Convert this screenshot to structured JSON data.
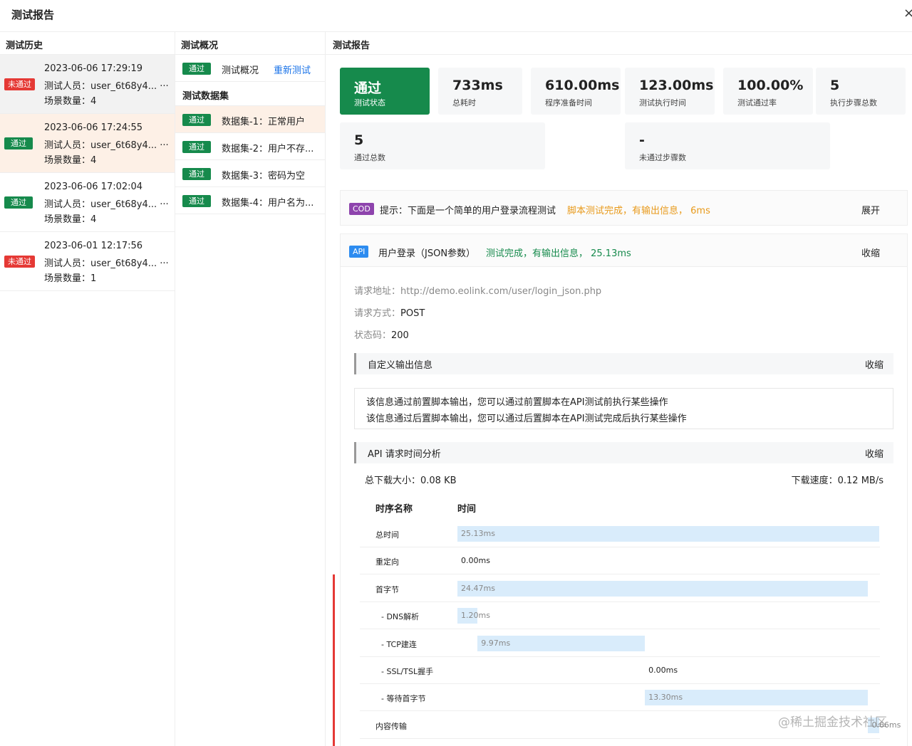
{
  "header": {
    "title": "测试报告",
    "close": "×"
  },
  "history": {
    "title": "测试历史",
    "items": [
      {
        "status": "未通过",
        "time": "2023-06-06 17:29:19",
        "tester": "测试人员：user_6t68y4... ···",
        "scenes": "场景数量：4"
      },
      {
        "status": "通过",
        "time": "2023-06-06 17:24:55",
        "tester": "测试人员：user_6t68y4... ···",
        "scenes": "场景数量：4"
      },
      {
        "status": "通过",
        "time": "2023-06-06 17:02:04",
        "tester": "测试人员：user_6t68y4... ···",
        "scenes": "场景数量：4"
      },
      {
        "status": "未通过",
        "time": "2023-06-01 12:17:56",
        "tester": "测试人员：user_6t68y4... ···",
        "scenes": "场景数量：1"
      }
    ]
  },
  "overview": {
    "title": "测试概况",
    "row": {
      "status": "通过",
      "label": "测试概况",
      "link": "重新测试"
    },
    "datasets_title": "测试数据集",
    "datasets": [
      {
        "status": "通过",
        "label": "数据集-1：正常用户"
      },
      {
        "status": "通过",
        "label": "数据集-2：用户不存..."
      },
      {
        "status": "通过",
        "label": "数据集-3：密码为空"
      },
      {
        "status": "通过",
        "label": "数据集-4：用户名为..."
      }
    ]
  },
  "report": {
    "title": "测试报告",
    "stats": [
      {
        "value": "通过",
        "label": "测试状态"
      },
      {
        "value": "733ms",
        "label": "总耗时"
      },
      {
        "value": "610.00ms",
        "label": "程序准备时间"
      },
      {
        "value": "123.00ms",
        "label": "测试执行时间"
      },
      {
        "value": "100.00%",
        "label": "测试通过率"
      },
      {
        "value": "5",
        "label": "执行步骤总数"
      },
      {
        "value": "5",
        "label": "通过总数"
      },
      {
        "value": "-",
        "label": "未通过步骤数"
      }
    ],
    "cod": {
      "badge": "COD",
      "text": "提示：下面是一个简单的用户登录流程测试",
      "result": "脚本测试完成，有输出信息， 6ms",
      "action": "展开"
    },
    "api": {
      "badge": "API",
      "text": "用户登录（JSON参数）",
      "result": "测试完成，有输出信息， 25.13ms",
      "action": "收缩"
    },
    "request": {
      "url_label": "请求地址：",
      "url": "http://demo.eolink.com/user/login_json.php",
      "method_label": "请求方式：",
      "method": "POST",
      "code_label": "状态码：",
      "code": "200"
    },
    "custom_output": {
      "title": "自定义输出信息",
      "action": "收缩",
      "lines": [
        "该信息通过前置脚本输出，您可以通过前置脚本在API测试前执行某些操作",
        "该信息通过后置脚本输出，您可以通过后置脚本在API测试完成后执行某些操作"
      ]
    },
    "timing": {
      "title": "API 请求时间分析",
      "action": "收缩",
      "download_size": "总下载大小：0.08 KB",
      "download_speed": "下载速度：0.12 MB/s",
      "col_name": "时序名称",
      "col_time": "时间",
      "rows": [
        {
          "name": "总时间",
          "value": "25.13ms",
          "start": 0,
          "duration": 25.13
        },
        {
          "name": "重定向",
          "value": "0.00ms",
          "start": 0,
          "duration": 0
        },
        {
          "name": "首字节",
          "value": "24.47ms",
          "start": 0,
          "duration": 24.47
        },
        {
          "name": "- DNS解析",
          "value": "1.20ms",
          "start": 0,
          "duration": 1.2
        },
        {
          "name": "- TCP建连",
          "value": "9.97ms",
          "start": 1.2,
          "duration": 9.97
        },
        {
          "name": "- SSL/TSL握手",
          "value": "0.00ms",
          "start": 11.17,
          "duration": 0
        },
        {
          "name": "- 等待首字节",
          "value": "13.30ms",
          "start": 11.17,
          "duration": 13.3
        },
        {
          "name": "内容传输",
          "value": "0.66ms",
          "start": 24.47,
          "duration": 0.66
        }
      ]
    }
  },
  "watermark": "@稀土掘金技术社区"
}
